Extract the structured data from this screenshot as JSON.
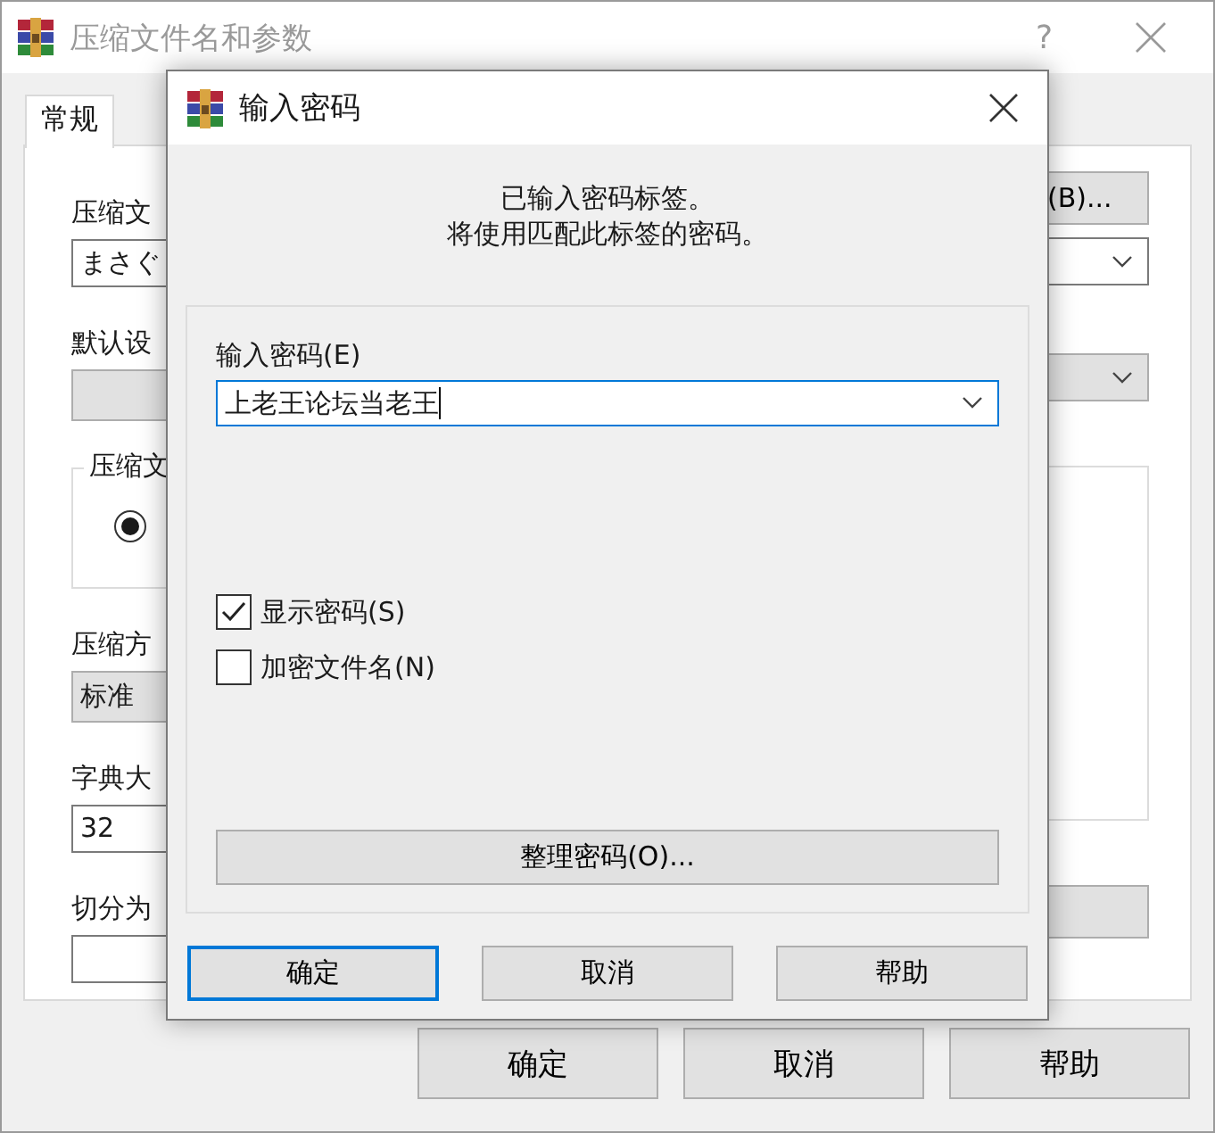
{
  "window": {
    "title": "压缩文件名和参数",
    "help": "?"
  },
  "tabs": [
    {
      "label": "常规",
      "selected": true
    }
  ],
  "left_column": [
    {
      "kind": "label",
      "text": "压缩文"
    },
    {
      "kind": "field",
      "value": "まさぐ"
    },
    {
      "kind": "label",
      "text": "默认设"
    },
    {
      "kind": "gray_field"
    },
    {
      "kind": "group",
      "legend": "压缩文",
      "radio_selected": true
    },
    {
      "kind": "label",
      "text": "压缩方"
    },
    {
      "kind": "gray_field",
      "value": "标准"
    },
    {
      "kind": "label",
      "text": "字典大"
    },
    {
      "kind": "field",
      "value": "32"
    },
    {
      "kind": "label",
      "text": "切分为"
    },
    {
      "kind": "field"
    }
  ],
  "right_column": [
    {
      "kind": "button",
      "label": "(B)..."
    },
    {
      "kind": "combo"
    },
    {
      "kind": "dropdown"
    },
    {
      "kind": "list"
    },
    {
      "kind": "button"
    }
  ],
  "buttons": [
    "确定",
    "取消",
    "帮助"
  ],
  "dialog": {
    "title": "输入密码",
    "message": [
      "已输入密码标签。",
      "将使用匹配此标签的密码。"
    ],
    "password_label": "输入密码(E)",
    "password_value": "上老王论坛当老王",
    "options": [
      {
        "label": "显示密码(S)",
        "checked": true
      },
      {
        "label": "加密文件名(N)",
        "checked": false
      }
    ],
    "organize_button": "整理密码(O)...",
    "buttons": [
      {
        "label": "确定",
        "default": true
      },
      {
        "label": "取消",
        "default": false
      },
      {
        "label": "帮助",
        "default": false
      }
    ]
  }
}
